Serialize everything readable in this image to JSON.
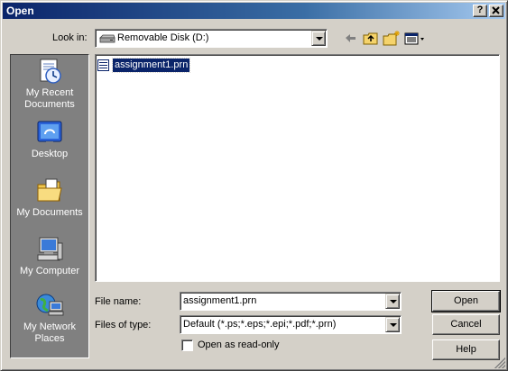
{
  "window": {
    "title": "Open",
    "help_btn": "?",
    "close_btn": "X"
  },
  "lookin": {
    "label": "Look in:",
    "value": "Removable Disk (D:)"
  },
  "toolbar": {
    "icons": [
      "back-icon",
      "up-folder-icon",
      "new-folder-icon",
      "view-menu-icon"
    ]
  },
  "places": {
    "items": [
      {
        "label": "My Recent Documents",
        "line1": "My Recent",
        "line2": "Documents",
        "icon": "recent-documents-icon"
      },
      {
        "label": "Desktop",
        "icon": "desktop-icon"
      },
      {
        "label": "My Documents",
        "icon": "my-documents-icon"
      },
      {
        "label": "My Computer",
        "icon": "my-computer-icon"
      },
      {
        "label": "My Network Places",
        "line1": "My Network",
        "line2": "Places",
        "icon": "network-places-icon"
      }
    ]
  },
  "files": [
    {
      "name": "assignment1.prn",
      "selected": true
    }
  ],
  "filename": {
    "label": "File name:",
    "value": "assignment1.prn"
  },
  "filetype": {
    "label": "Files of type:",
    "value": "Default (*.ps;*.eps;*.epi;*.pdf;*.prn)"
  },
  "readonly": {
    "label": "Open as read-only",
    "checked": false
  },
  "buttons": {
    "open": "Open",
    "cancel": "Cancel",
    "help": "Help"
  },
  "colors": {
    "title_bar": "#0a246a",
    "face": "#d4d0c8",
    "places_bg": "#808080",
    "selection": "#0a246a"
  }
}
